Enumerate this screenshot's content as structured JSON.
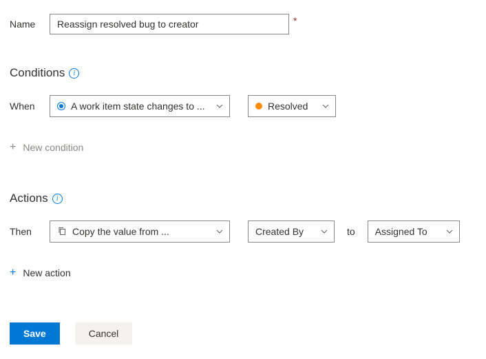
{
  "name": {
    "label": "Name",
    "value": "Reassign resolved bug to creator"
  },
  "conditions": {
    "heading": "Conditions",
    "when_label": "When",
    "trigger": "A work item state changes to ...",
    "state": "Resolved",
    "add_label": "New condition"
  },
  "actions": {
    "heading": "Actions",
    "then_label": "Then",
    "action_text": "Copy the value from ...",
    "from_field": "Created By",
    "to_label": "to",
    "to_field": "Assigned To",
    "add_label": "New action"
  },
  "footer": {
    "save": "Save",
    "cancel": "Cancel"
  }
}
